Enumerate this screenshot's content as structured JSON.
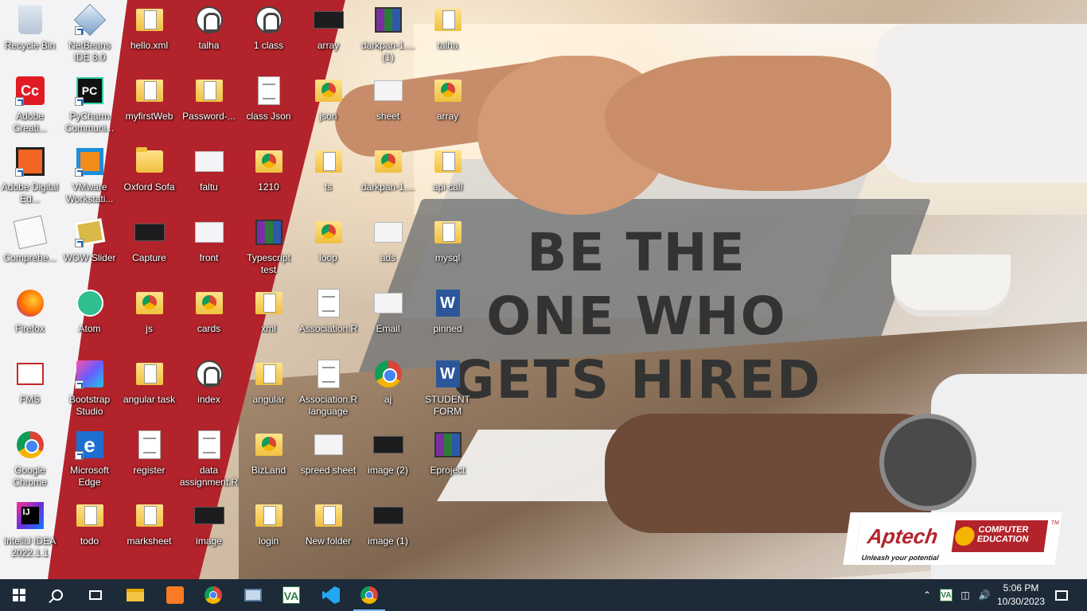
{
  "desktop": {
    "wallpaper": {
      "slogan": [
        "BE THE",
        "ONE WHO",
        "GETS HIRED"
      ],
      "brand": {
        "name": "Aptech",
        "line1": "COMPUTER",
        "line2": "EDUCATION",
        "tagline": "Unleash your potential",
        "tm": "TM"
      },
      "colors": {
        "red": "#b3232b",
        "slogan": "#333333"
      }
    },
    "columns": [
      [
        {
          "label": "Recycle Bin",
          "icon": "recycle-bin-icon",
          "glyph": "g-recycle",
          "shortcut": false
        },
        {
          "label": "Adobe Creati...",
          "icon": "adobe-creative-cloud-icon",
          "glyph": "g-adobe",
          "shortcut": true
        },
        {
          "label": "Adobe Digital Ed...",
          "icon": "adobe-digital-editions-icon",
          "glyph": "g-de",
          "shortcut": true
        },
        {
          "label": "Comprehe...",
          "icon": "comprehensive-app-icon",
          "glyph": "g-note",
          "shortcut": false
        },
        {
          "label": "Firefox",
          "icon": "firefox-icon",
          "glyph": "g-firefox",
          "shortcut": false
        },
        {
          "label": "FMS",
          "icon": "fms-icon",
          "glyph": "g-fms",
          "shortcut": false
        },
        {
          "label": "Google Chrome",
          "icon": "chrome-icon",
          "glyph": "g-chrome",
          "shortcut": false
        },
        {
          "label": "IntelliJ IDEA 2022.1.1",
          "icon": "intellij-icon",
          "glyph": "g-ij",
          "shortcut": false
        }
      ],
      [
        {
          "label": "NetBeans IDE 8.0",
          "icon": "netbeans-icon",
          "glyph": "g-netbeans",
          "shortcut": true
        },
        {
          "label": "PyCharm Communi...",
          "icon": "pycharm-icon",
          "glyph": "g-pc",
          "shortcut": true
        },
        {
          "label": "VMware Workstati...",
          "icon": "vmware-icon",
          "glyph": "g-vmware",
          "shortcut": true
        },
        {
          "label": "WOW Slider",
          "icon": "wow-slider-icon",
          "glyph": "g-wow",
          "shortcut": true
        },
        {
          "label": "Atom",
          "icon": "atom-icon",
          "glyph": "g-atom",
          "shortcut": false
        },
        {
          "label": "Bootstrap Studio",
          "icon": "bootstrap-studio-icon",
          "glyph": "g-bs",
          "shortcut": true
        },
        {
          "label": "Microsoft Edge",
          "icon": "edge-icon",
          "glyph": "g-edge",
          "shortcut": true
        },
        {
          "label": "todo",
          "icon": "folder-icon",
          "glyph": "g-folder-doc",
          "shortcut": false
        }
      ],
      [
        {
          "label": "hello.xml",
          "icon": "xml-file-icon",
          "glyph": "g-folder-doc",
          "shortcut": false
        },
        {
          "label": "myfirstWeb",
          "icon": "folder-icon",
          "glyph": "g-folder-doc",
          "shortcut": false
        },
        {
          "label": "Oxford Sofa",
          "icon": "folder-icon",
          "glyph": "g-folder",
          "shortcut": false
        },
        {
          "label": "Capture",
          "icon": "image-file-icon",
          "glyph": "g-dark",
          "shortcut": false
        },
        {
          "label": "js",
          "icon": "chrome-folder-icon",
          "glyph": "g-chrome-folder",
          "shortcut": false
        },
        {
          "label": "angular task",
          "icon": "folder-icon",
          "glyph": "g-folder-doc",
          "shortcut": false
        },
        {
          "label": "register",
          "icon": "text-file-icon",
          "glyph": "g-doc",
          "shortcut": false
        },
        {
          "label": "marksheet",
          "icon": "folder-icon",
          "glyph": "g-folder-doc",
          "shortcut": false
        }
      ],
      [
        {
          "label": "talha",
          "icon": "media-file-icon",
          "glyph": "g-media",
          "shortcut": false
        },
        {
          "label": "Password-...",
          "icon": "folder-icon",
          "glyph": "g-folder-doc",
          "shortcut": false
        },
        {
          "label": "faltu",
          "icon": "image-file-icon",
          "glyph": "g-thumb",
          "shortcut": false
        },
        {
          "label": "front",
          "icon": "image-file-icon",
          "glyph": "g-thumb",
          "shortcut": false
        },
        {
          "label": "cards",
          "icon": "chrome-folder-icon",
          "glyph": "g-chrome-folder",
          "shortcut": false
        },
        {
          "label": "index",
          "icon": "media-file-icon",
          "glyph": "g-media",
          "shortcut": false
        },
        {
          "label": "data assignment.R",
          "icon": "r-file-icon",
          "glyph": "g-doc",
          "shortcut": false
        },
        {
          "label": "image",
          "icon": "image-file-icon",
          "glyph": "g-dark",
          "shortcut": false
        }
      ],
      [
        {
          "label": "1 class",
          "icon": "media-file-icon",
          "glyph": "g-media",
          "shortcut": false
        },
        {
          "label": "class Json",
          "icon": "text-file-icon",
          "glyph": "g-doc",
          "shortcut": false
        },
        {
          "label": "1210",
          "icon": "chrome-html-icon",
          "glyph": "g-chrome-folder",
          "shortcut": false
        },
        {
          "label": "Typescript test",
          "icon": "winrar-icon",
          "glyph": "g-rar",
          "shortcut": false
        },
        {
          "label": "xml",
          "icon": "folder-icon",
          "glyph": "g-folder-doc",
          "shortcut": false
        },
        {
          "label": "angular",
          "icon": "folder-icon",
          "glyph": "g-folder-doc",
          "shortcut": false
        },
        {
          "label": "BizLand",
          "icon": "chrome-folder-icon",
          "glyph": "g-chrome-folder",
          "shortcut": false
        },
        {
          "label": "login",
          "icon": "folder-icon",
          "glyph": "g-folder-doc",
          "shortcut": false
        }
      ],
      [
        {
          "label": "array",
          "icon": "image-file-icon",
          "glyph": "g-dark",
          "shortcut": false
        },
        {
          "label": "json",
          "icon": "chrome-folder-icon",
          "glyph": "g-chrome-folder",
          "shortcut": false
        },
        {
          "label": "ts",
          "icon": "folder-icon",
          "glyph": "g-folder-doc",
          "shortcut": false
        },
        {
          "label": "loop",
          "icon": "chrome-folder-icon",
          "glyph": "g-chrome-folder",
          "shortcut": false
        },
        {
          "label": "Association.R",
          "icon": "r-file-icon",
          "glyph": "g-doc",
          "shortcut": false
        },
        {
          "label": "Association.R language",
          "icon": "text-file-icon",
          "glyph": "g-doc",
          "shortcut": false
        },
        {
          "label": "spreed sheet",
          "icon": "image-file-icon",
          "glyph": "g-thumb",
          "shortcut": false
        },
        {
          "label": "New folder",
          "icon": "folder-icon",
          "glyph": "g-folder-doc",
          "shortcut": false
        }
      ],
      [
        {
          "label": "darkpan-1.... (1)",
          "icon": "winrar-icon",
          "glyph": "g-rar",
          "shortcut": false
        },
        {
          "label": "sheet",
          "icon": "image-file-icon",
          "glyph": "g-thumb",
          "shortcut": false
        },
        {
          "label": "darkpan-1....",
          "icon": "chrome-folder-icon",
          "glyph": "g-chrome-folder",
          "shortcut": false
        },
        {
          "label": "ads",
          "icon": "image-file-icon",
          "glyph": "g-thumb",
          "shortcut": false
        },
        {
          "label": "Email",
          "icon": "image-file-icon",
          "glyph": "g-thumb",
          "shortcut": false
        },
        {
          "label": "aj",
          "icon": "chrome-html-icon",
          "glyph": "g-chrome",
          "shortcut": false
        },
        {
          "label": "image (2)",
          "icon": "image-file-icon",
          "glyph": "g-dark",
          "shortcut": false
        },
        {
          "label": "image (1)",
          "icon": "image-file-icon",
          "glyph": "g-dark",
          "shortcut": false
        }
      ],
      [
        {
          "label": "talha",
          "icon": "folder-icon",
          "glyph": "g-folder-doc",
          "shortcut": false
        },
        {
          "label": "array",
          "icon": "chrome-folder-icon",
          "glyph": "g-chrome-folder",
          "shortcut": false
        },
        {
          "label": "api call",
          "icon": "folder-icon",
          "glyph": "g-folder-doc",
          "shortcut": false
        },
        {
          "label": "mysql",
          "icon": "folder-icon",
          "glyph": "g-folder-doc",
          "shortcut": false
        },
        {
          "label": "pinned",
          "icon": "word-doc-icon",
          "glyph": "g-word",
          "shortcut": false
        },
        {
          "label": "STUDENT FORM",
          "icon": "word-doc-icon",
          "glyph": "g-word",
          "shortcut": false
        },
        {
          "label": "Eproject",
          "icon": "winrar-icon",
          "glyph": "g-rar",
          "shortcut": false
        }
      ]
    ]
  },
  "taskbar": {
    "pinned": [
      {
        "name": "start-button",
        "glyph": "start"
      },
      {
        "name": "search-button",
        "glyph": "search"
      },
      {
        "name": "task-view-button",
        "glyph": "taskview"
      },
      {
        "name": "file-explorer-button",
        "glyph": "explorer"
      },
      {
        "name": "xampp-button",
        "glyph": "xampp"
      },
      {
        "name": "chrome-button",
        "glyph": "chrome"
      },
      {
        "name": "vm-button",
        "glyph": "vm"
      },
      {
        "name": "va-button",
        "glyph": "va"
      },
      {
        "name": "vscode-button",
        "glyph": "vscode"
      },
      {
        "name": "chrome-profile-button",
        "glyph": "chrome"
      }
    ],
    "time": "5:06 PM",
    "date": "10/30/2023",
    "colors": {
      "background": "#1d2a38",
      "active": "#7ab8ff"
    }
  }
}
